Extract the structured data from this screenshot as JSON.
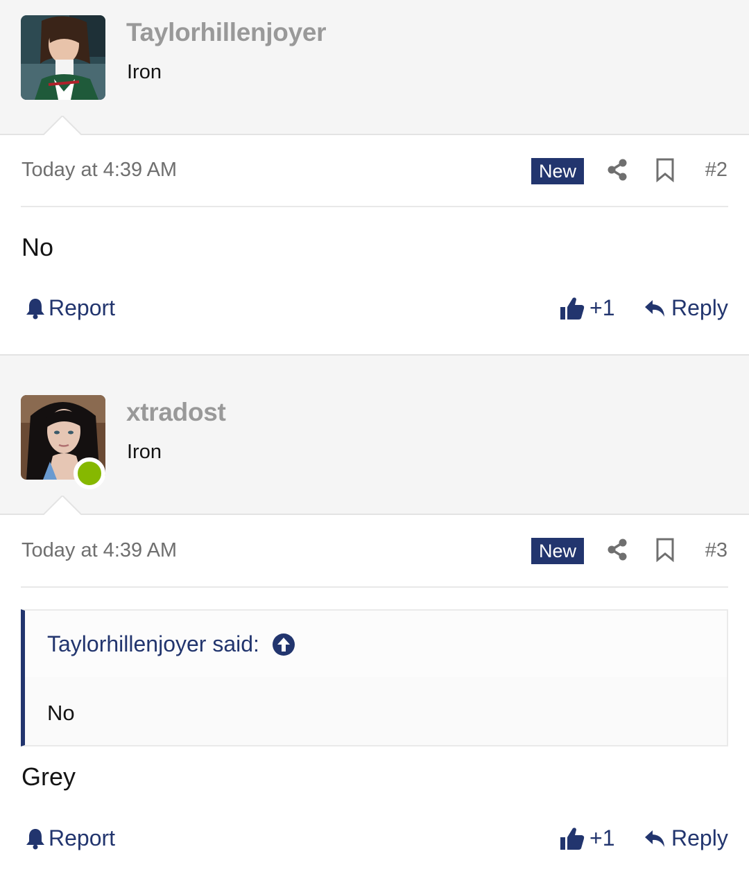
{
  "posts": [
    {
      "username": "Taylorhillenjoyer",
      "user_title": "Iron",
      "date": "Today at 4:39 AM",
      "badge": "New",
      "post_number": "#2",
      "message": "No",
      "report_label": "Report",
      "like_label": "+1",
      "reply_label": "Reply",
      "online": false
    },
    {
      "username": "xtradost",
      "user_title": "Iron",
      "date": "Today at 4:39 AM",
      "badge": "New",
      "post_number": "#3",
      "quote": {
        "attribution": "Taylorhillenjoyer said:",
        "text": "No"
      },
      "message": "Grey",
      "report_label": "Report",
      "like_label": "+1",
      "reply_label": "Reply",
      "online": true
    }
  ],
  "colors": {
    "accent": "#22356e",
    "online": "#86b800",
    "muted_text": "#6f6f6f",
    "username": "#999999",
    "header_bg": "#f5f5f5"
  },
  "icons": [
    "share-icon",
    "bookmark-icon",
    "bell-icon",
    "thumbs-up-icon",
    "reply-arrow-icon",
    "arrow-up-circle-icon"
  ]
}
